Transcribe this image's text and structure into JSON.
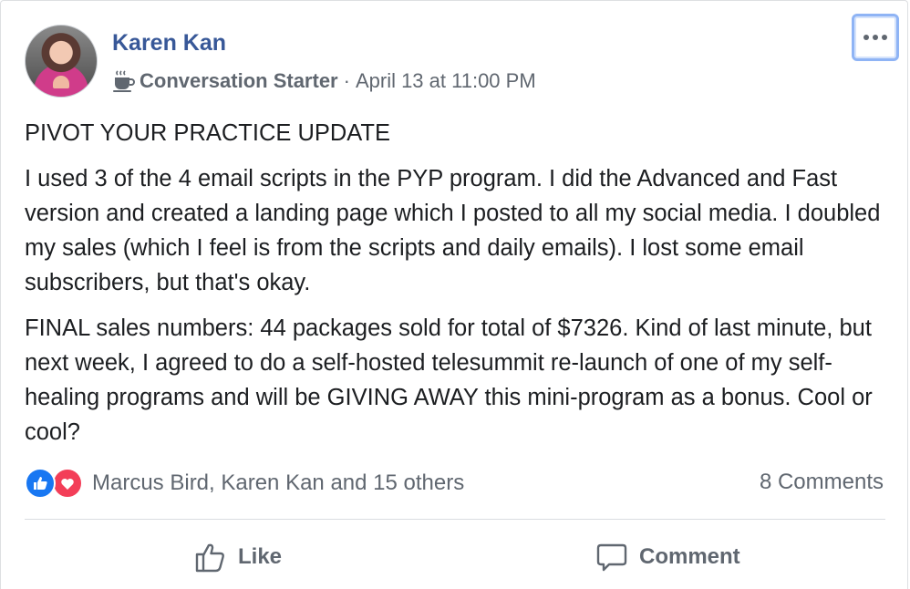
{
  "post": {
    "author": "Karen Kan",
    "badge": "Conversation Starter",
    "separator": "·",
    "timestamp": "April 13 at 11:00 PM",
    "headline": "PIVOT YOUR PRACTICE UPDATE",
    "paragraphs": [
      "I used 3 of the 4 email scripts in the PYP program. I did the Advanced and Fast version and created a landing page which I posted to all my social media. I doubled my sales (which I feel is from the scripts and daily emails). I lost some email subscribers, but that's okay.",
      "FINAL sales numbers: 44 packages sold for total of $7326. Kind of last minute, but next week, I agreed to do a self-hosted telesummit re-launch of one of my self-healing programs and will be GIVING AWAY this mini-program as a bonus. Cool or cool?"
    ]
  },
  "engagement": {
    "reaction_icons": [
      "like-icon",
      "love-icon"
    ],
    "reactors": "Marcus Bird, Karen Kan and 15 others",
    "comments": "8 Comments"
  },
  "actions": {
    "like_label": "Like",
    "comment_label": "Comment"
  },
  "icons": {
    "more": "more-options-icon",
    "badge": "coffee-cup-icon",
    "like_action": "thumbs-up-outline-icon",
    "comment_action": "speech-bubble-icon"
  },
  "colors": {
    "author_link": "#385898",
    "secondary_text": "#606770",
    "like_blue": "#1877f2",
    "love_red": "#f33e58",
    "focus_ring": "#8fb4f5"
  }
}
